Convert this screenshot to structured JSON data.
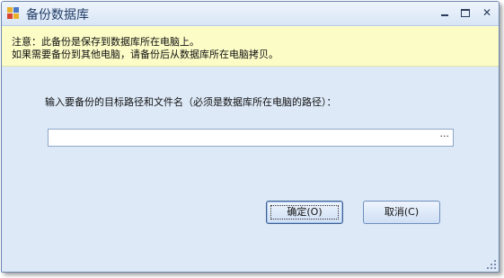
{
  "window": {
    "title": "备份数据库"
  },
  "title_controls": {
    "minimize_icon": "minimize-icon",
    "maximize_icon": "maximize-icon",
    "close_label": "✕"
  },
  "notice": {
    "line1": "注意：此备份是保存到数据库所在电脑上。",
    "line2": "如果需要备份到其他电脑，请备份后从数据库所在电脑拷贝。"
  },
  "form": {
    "prompt": "输入要备份的目标路径和文件名（必须是数据库所在电脑的路径）：",
    "path_value": "",
    "browse_label": "···"
  },
  "buttons": {
    "ok_label": "确定(O)",
    "cancel_label": "取消(C)"
  },
  "colors": {
    "notice_bg": "#fcfcc7",
    "window_bg": "#dde9f7",
    "title_text": "#243f68"
  }
}
